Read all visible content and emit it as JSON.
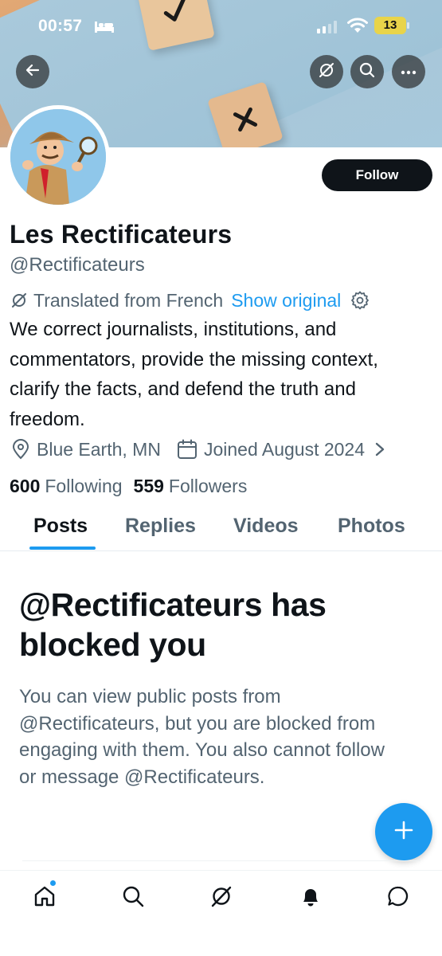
{
  "status_bar": {
    "time": "00:57",
    "battery": "13"
  },
  "profile": {
    "display_name": "Les Rectificateurs",
    "handle": "@Rectificateurs",
    "follow_label": "Follow",
    "translated_label": "Translated from French",
    "show_original_label": "Show original",
    "bio": "We correct journalists, institutions, and commentators, provide the missing context, clarify the facts, and defend the truth and freedom.",
    "location": "Blue Earth, MN",
    "joined": "Joined August 2024",
    "following_count": "600",
    "following_label": "Following",
    "followers_count": "559",
    "followers_label": "Followers"
  },
  "tabs": [
    {
      "label": "Posts",
      "active": true
    },
    {
      "label": "Replies",
      "active": false
    },
    {
      "label": "Videos",
      "active": false
    },
    {
      "label": "Photos",
      "active": false
    }
  ],
  "blocked": {
    "title": "@Rectificateurs has blocked you",
    "message": "You can view public posts from @Rectificateurs, but you are blocked from engaging with them. You also cannot follow or message @Rectificateurs."
  },
  "icons": {
    "header": [
      "back-arrow-icon",
      "grok-icon",
      "search-icon",
      "more-icon"
    ],
    "bottom_nav": [
      "home-icon",
      "search-icon",
      "grok-icon",
      "notifications-icon",
      "messages-icon"
    ],
    "fab": "plus-icon"
  },
  "colors": {
    "accent": "#1d9bf0",
    "text_primary": "#0f1419",
    "text_secondary": "#536471",
    "follow_button": "#0f1419",
    "battery": "#e9d44a"
  }
}
